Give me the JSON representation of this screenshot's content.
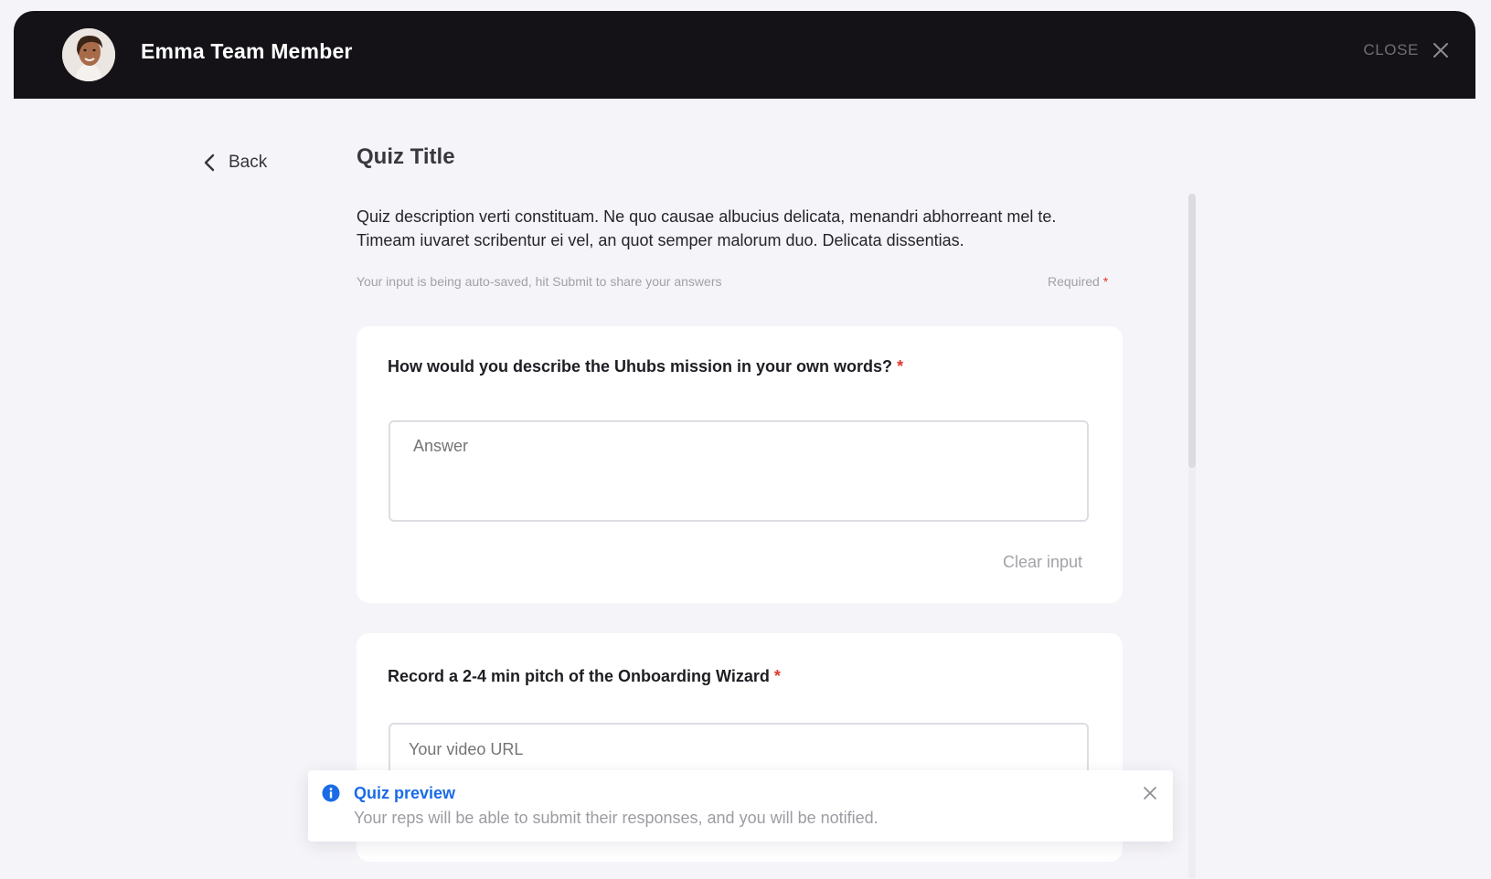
{
  "header": {
    "user_name": "Emma Team Member",
    "close_label": "CLOSE"
  },
  "nav": {
    "back_label": "Back"
  },
  "quiz": {
    "title": "Quiz Title",
    "description": "Quiz description verti constituam. Ne quo causae albucius delicata, menandri abhorreant mel te. Timeam iuvaret scribentur ei vel, an quot semper malorum duo. Delicata dissentias.",
    "autosave_note": "Your input is being auto-saved, hit Submit to share your answers",
    "required_label": "Required",
    "required_marker": "*"
  },
  "questions": [
    {
      "text": "How would you describe the Uhubs mission in your own words?",
      "required_marker": "*",
      "placeholder": "Answer",
      "clear_label": "Clear input"
    },
    {
      "text": "Record a 2-4 min pitch of the Onboarding Wizard",
      "required_marker": "*",
      "placeholder": "Your video URL"
    }
  ],
  "toast": {
    "title": "Quiz preview",
    "message": "Your reps will be able to submit their responses, and you will be notified.",
    "icon": "info-icon"
  },
  "colors": {
    "header_bg": "#141216",
    "page_bg": "#f5f4f8",
    "required_star": "#e0392f",
    "toast_accent": "#1a6ce6"
  }
}
